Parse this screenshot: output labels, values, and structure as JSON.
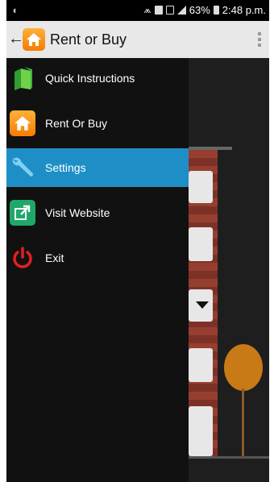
{
  "status_bar": {
    "time": "2:48 p.m.",
    "battery": "63%"
  },
  "action_bar": {
    "back": "←",
    "title": "Rent or Buy"
  },
  "drawer": {
    "items": [
      {
        "label": "Quick Instructions",
        "icon": "book-icon",
        "active": false
      },
      {
        "label": "Rent Or Buy",
        "icon": "house-icon",
        "active": false
      },
      {
        "label": "Settings",
        "icon": "wrench-icon",
        "active": true
      },
      {
        "label": "Visit Website",
        "icon": "external-link-icon",
        "active": false
      },
      {
        "label": "Exit",
        "icon": "power-icon",
        "active": false
      }
    ]
  },
  "colors": {
    "accent": "#1e8fc6",
    "drawer_bg": "#111111",
    "action_bar_bg": "#e8e8e8"
  }
}
